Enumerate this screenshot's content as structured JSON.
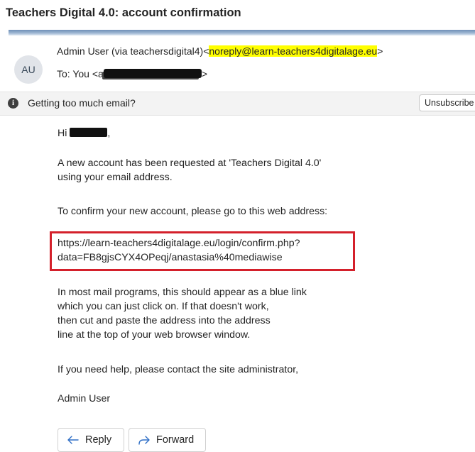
{
  "email": {
    "subject": "Teachers Digital 4.0: account confirmation",
    "avatar_initials": "AU",
    "sender_name": "Admin User (via teachersdigital4)",
    "sender_email": "noreply@learn-teachers4digitalage.eu",
    "to_label": "To:",
    "to_name": "You",
    "banner_text": "Getting too much email?",
    "unsubscribe_label": "Unsubscribe",
    "greeting_prefix": "Hi ",
    "greeting_suffix": ",",
    "body": {
      "p1_line1": "A new account has been requested at 'Teachers Digital 4.0'",
      "p1_line2": "using your email address.",
      "p2": "To confirm your new account, please go to this web address:",
      "link_line1": "https://learn-teachers4digitalage.eu/login/confirm.php?",
      "link_line2": "data=FB8gjsCYX4OPeqj/anastasia%40mediawise",
      "p3_line1": "In most mail programs, this should appear as a blue link",
      "p3_line2": "which you can just click on. If that doesn't work,",
      "p3_line3": "then cut and paste the address into the address",
      "p3_line4": "line at the top of your web browser window.",
      "p4": "If you need help, please contact the site administrator,",
      "signature": "Admin User"
    },
    "actions": {
      "reply_label": "Reply",
      "forward_label": "Forward"
    }
  }
}
